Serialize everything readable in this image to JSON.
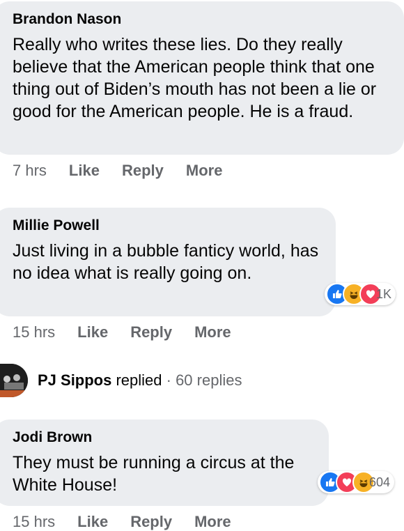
{
  "comments": [
    {
      "author": "Brandon Nason",
      "text": "Really who writes these lies. Do they really believe that the American people think that one thing out of Biden’s mouth has not been a lie or good for the American people. He is a fraud.",
      "time": "7 hrs",
      "like": "Like",
      "reply": "Reply",
      "more": "More"
    },
    {
      "author": "Millie Powell",
      "text": "Just living in a bubble fanticy world, has no idea what is really going on.",
      "time": "15 hrs",
      "like": "Like",
      "reply": "Reply",
      "more": "More",
      "reaction_count": "1K",
      "reaction_icons": [
        "like-icon",
        "haha-icon",
        "love-icon"
      ]
    },
    {
      "author": "Jodi Brown",
      "text": "They must be running a circus at the White House!",
      "time": "15 hrs",
      "like": "Like",
      "reply": "Reply",
      "more": "More",
      "reaction_count": "604",
      "reaction_icons": [
        "like-icon",
        "love-icon",
        "haha-icon"
      ]
    }
  ],
  "reply_summary": {
    "name": "PJ Sippos",
    "action": " replied",
    "meta": " · 60 replies"
  },
  "colors": {
    "bubble": "#ebedf0",
    "secondary_text": "#65676b",
    "like": "#1877f2",
    "love": "#f33e58",
    "haha": "#f7b125"
  }
}
